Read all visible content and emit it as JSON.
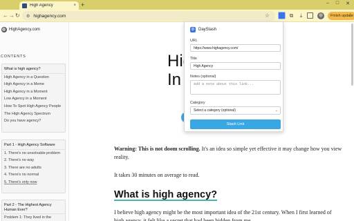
{
  "browser": {
    "tab_title": "High Agency",
    "tab_close": "×",
    "new_tab": "+",
    "win_min": "–",
    "win_max": "□",
    "win_close": "✕",
    "back": "←",
    "forward": "→",
    "reload": "↻",
    "omnibox_icon": "⚙",
    "url": "highagency.com",
    "star": "☆",
    "puzzle": "⧉",
    "download": "⤓",
    "finish_update": "Finish update",
    "menu": "⋮"
  },
  "page": {
    "brand": "HighAgency.com",
    "toc_title": "CONTENTS",
    "toc_groups": [
      {
        "items": [
          "What is high agency?",
          "High Agency in a Question",
          "High Agency in a Meme",
          "High Agency in a Moment",
          "Low Agency in a Moment",
          "How To Spot High Agency People",
          "The High Agency Spectrum",
          "Do you have agency?"
        ]
      },
      {
        "items": [
          "Part 1 - High Agency Software",
          "1. There's no unsolvable problem",
          "2. There's no way",
          "3. There are no adults",
          "4. There's no normal",
          "5. There's only now"
        ]
      },
      {
        "items": [
          "Part 2 - The Highest Agency Human Ever?",
          "Problem 1: They lived in the"
        ]
      }
    ],
    "hero_line1": "Hig",
    "hero_line2": "In ",
    "warning_bold": "Warning: This is not doom scrolling.",
    "warning_rest": " It's an idea so simple yet effective it may change how you view reality.",
    "read_time": "It takes 30 minutes on average to read.",
    "section_heading": "What is high agency?",
    "body_text": "I believe high agency might be the most important idea of the 21st century. When I first learned of high agency, it felt like a secret that had been hidden from me."
  },
  "popup": {
    "logo_letter": "D",
    "title": "DayStash",
    "url_label": "URL",
    "url_value": "https://www.highagency.com/",
    "title_label": "Title",
    "title_value": "High Agency",
    "notes_label": "Notes (optional)",
    "notes_placeholder": "Add a note about this link...",
    "category_label": "Category",
    "category_value": "Select a category (optional)",
    "category_caret": "⌄",
    "submit_label": "Stash Link"
  },
  "colors": {
    "chrome_accent": "#d9cf6a",
    "toolbar_bg": "#fbf5c8",
    "update_button": "#f2b84b",
    "extension_blue": "#3d73e6",
    "stash_button": "#39a7e3",
    "heading_underline": "#3fb6a8"
  }
}
